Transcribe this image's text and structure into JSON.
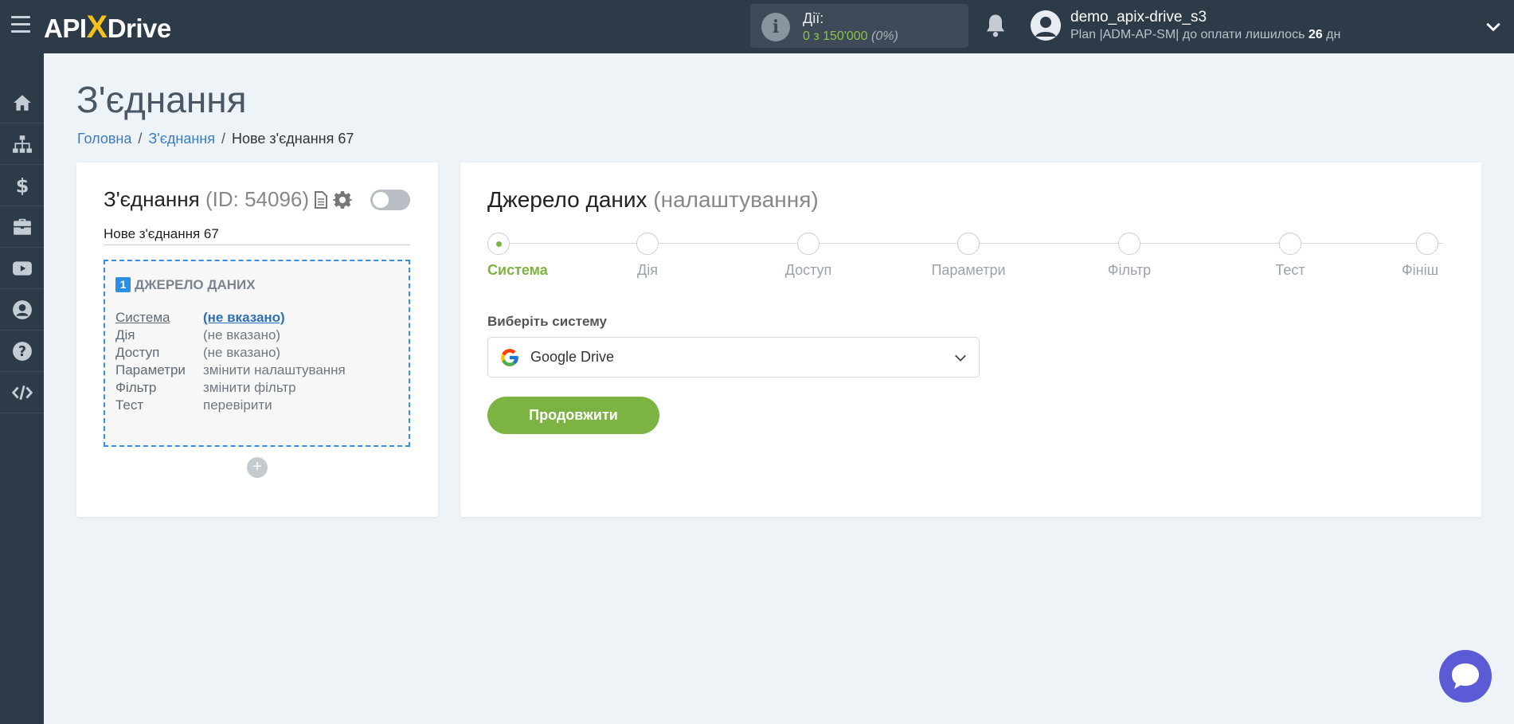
{
  "brand": {
    "logo_part1": "API",
    "logo_x": "X",
    "logo_part2": "Drive"
  },
  "header": {
    "actions_label": "Дії:",
    "actions_value": "0 з 150'000",
    "actions_percent": "(0%)",
    "username": "demo_apix-drive_s3",
    "plan_text": "Plan |ADM-AP-SM| до оплати лишилось ",
    "plan_days": "26",
    "plan_days_unit": " дн"
  },
  "sidebar": {
    "items": [
      {
        "name": "home-icon"
      },
      {
        "name": "sitemap-icon"
      },
      {
        "name": "dollar-icon"
      },
      {
        "name": "briefcase-icon"
      },
      {
        "name": "youtube-icon"
      },
      {
        "name": "user-icon"
      },
      {
        "name": "help-icon"
      },
      {
        "name": "code-icon"
      }
    ]
  },
  "page": {
    "title": "З'єднання",
    "breadcrumb": {
      "home": "Головна",
      "connections": "З'єднання",
      "current": "Нове з'єднання 67"
    }
  },
  "connection": {
    "title": "З'єднання",
    "id_text": "(ID: 54096)",
    "name": "Нове з'єднання 67",
    "enabled": false,
    "source": {
      "number": "1",
      "heading": "ДЖЕРЕЛО ДАНИХ",
      "rows": [
        {
          "key": "Система",
          "value": "(не вказано)"
        },
        {
          "key": "Дія",
          "value": "(не вказано)"
        },
        {
          "key": "Доступ",
          "value": "(не вказано)"
        },
        {
          "key": "Параметри",
          "value": "змінити налаштування"
        },
        {
          "key": "Фільтр",
          "value": "змінити фільтр"
        },
        {
          "key": "Тест",
          "value": "перевірити"
        }
      ]
    },
    "add_symbol": "+"
  },
  "datasource": {
    "title": "Джерело даних",
    "subtitle": "(налаштування)",
    "steps": [
      "Система",
      "Дія",
      "Доступ",
      "Параметри",
      "Фільтр",
      "Тест",
      "Фініш"
    ],
    "active_step": 0,
    "select_label": "Виберіть систему",
    "select_value": "Google Drive",
    "continue_label": "Продовжити"
  },
  "colors": {
    "accent_green": "#7cb342",
    "link_blue": "#3b7cc0",
    "dark_bg": "#2d3a48",
    "dashed_border": "#3b8de0"
  }
}
